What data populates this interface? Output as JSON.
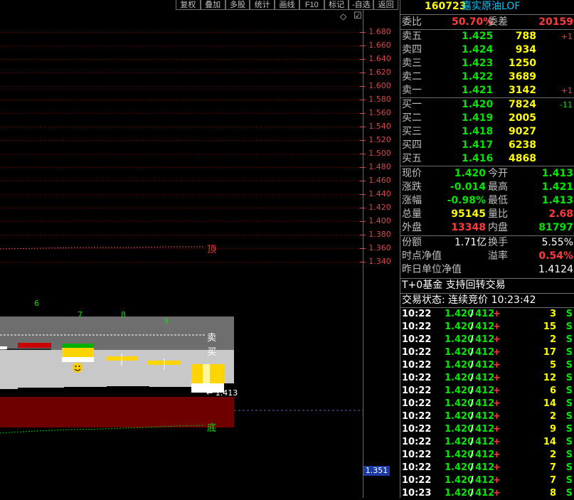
{
  "toolbar": {
    "items": [
      "复权",
      "叠加",
      "多股",
      "统计",
      "画线",
      "F10",
      "标记",
      "-自选",
      "返回"
    ]
  },
  "chart": {
    "price_axis": [
      "1.680",
      "1.660",
      "1.640",
      "1.620",
      "1.600",
      "1.580",
      "1.560",
      "1.540",
      "1.520",
      "1.500",
      "1.480",
      "1.460",
      "1.440",
      "1.420",
      "1.400",
      "1.380",
      "1.360",
      "1.340"
    ],
    "current_price_marker": "1.351",
    "top_label": "顶",
    "bottom_label": "底",
    "sell_label": "卖",
    "buy_label": "买",
    "low_annotation": "← 1.413",
    "count_labels": [
      "6",
      "7",
      "8",
      "9"
    ],
    "diamond_icon": "◇",
    "checkbox_icon": "☑"
  },
  "header": {
    "code": "160723",
    "name": "嘉实原油LOF"
  },
  "ratio": {
    "label1": "委比",
    "value1": "50.70%",
    "label2": "委差",
    "value2": "20159"
  },
  "asks": [
    {
      "label": "卖五",
      "price": "1.425",
      "vol": "788",
      "chg": "+1"
    },
    {
      "label": "卖四",
      "price": "1.424",
      "vol": "934",
      "chg": ""
    },
    {
      "label": "卖三",
      "price": "1.423",
      "vol": "1250",
      "chg": ""
    },
    {
      "label": "卖二",
      "price": "1.422",
      "vol": "3689",
      "chg": ""
    },
    {
      "label": "卖一",
      "price": "1.421",
      "vol": "3142",
      "chg": "+1"
    }
  ],
  "bids": [
    {
      "label": "买一",
      "price": "1.420",
      "vol": "7824",
      "chg": "-11"
    },
    {
      "label": "买二",
      "price": "1.419",
      "vol": "2005",
      "chg": ""
    },
    {
      "label": "买三",
      "price": "1.418",
      "vol": "9027",
      "chg": ""
    },
    {
      "label": "买四",
      "price": "1.417",
      "vol": "6238",
      "chg": ""
    },
    {
      "label": "买五",
      "price": "1.416",
      "vol": "4868",
      "chg": ""
    }
  ],
  "quote": [
    {
      "l1": "现价",
      "v1": "1.420",
      "l2": "今开",
      "v2": "1.413"
    },
    {
      "l1": "涨跌",
      "v1": "-0.014",
      "l2": "最高",
      "v2": "1.421"
    },
    {
      "l1": "涨幅",
      "v1": "-0.98%",
      "l2": "最低",
      "v2": "1.413"
    },
    {
      "l1": "总量",
      "v1": "95145",
      "l2": "量比",
      "v2": "2.68"
    },
    {
      "l1": "外盘",
      "v1": "13348",
      "l2": "内盘",
      "v2": "81797"
    }
  ],
  "fund": {
    "amount_label": "份额",
    "amount": "1.71亿",
    "turnover_label": "换手",
    "turnover": "5.55%",
    "nav_label": "时点净值",
    "premium_label": "溢率",
    "premium": "0.54%",
    "prev_nav_label": "昨日单位净值",
    "prev_nav": "1.4124"
  },
  "info": {
    "t0": "T+0基金 支持回转交易",
    "status": "交易状态: 连续竞价 10:23:42"
  },
  "ticks": [
    {
      "time": "10:22",
      "price": "1.420",
      "sub": "412",
      "dir": "+",
      "vol": "3",
      "side": "S"
    },
    {
      "time": "10:22",
      "price": "1.420",
      "sub": "412",
      "dir": "+",
      "vol": "15",
      "side": "S"
    },
    {
      "time": "10:22",
      "price": "1.420",
      "sub": "412",
      "dir": "+",
      "vol": "2",
      "side": "S"
    },
    {
      "time": "10:22",
      "price": "1.420",
      "sub": "412",
      "dir": "+",
      "vol": "17",
      "side": "S"
    },
    {
      "time": "10:22",
      "price": "1.420",
      "sub": "412",
      "dir": "+",
      "vol": "5",
      "side": "S"
    },
    {
      "time": "10:22",
      "price": "1.420",
      "sub": "412",
      "dir": "+",
      "vol": "12",
      "side": "S"
    },
    {
      "time": "10:22",
      "price": "1.420",
      "sub": "412",
      "dir": "+",
      "vol": "6",
      "side": "S"
    },
    {
      "time": "10:22",
      "price": "1.420",
      "sub": "412",
      "dir": "+",
      "vol": "14",
      "side": "S"
    },
    {
      "time": "10:22",
      "price": "1.420",
      "sub": "412",
      "dir": "+",
      "vol": "2",
      "side": "S"
    },
    {
      "time": "10:22",
      "price": "1.420",
      "sub": "412",
      "dir": "+",
      "vol": "9",
      "side": "S"
    },
    {
      "time": "10:22",
      "price": "1.420",
      "sub": "412",
      "dir": "+",
      "vol": "14",
      "side": "S"
    },
    {
      "time": "10:22",
      "price": "1.420",
      "sub": "412",
      "dir": "+",
      "vol": "2",
      "side": "S"
    },
    {
      "time": "10:22",
      "price": "1.420",
      "sub": "412",
      "dir": "+",
      "vol": "7",
      "side": "S"
    },
    {
      "time": "10:22",
      "price": "1.420",
      "sub": "412",
      "dir": "+",
      "vol": "7",
      "side": "S"
    },
    {
      "time": "10:23",
      "price": "1.420",
      "sub": "412",
      "dir": "+",
      "vol": "8",
      "side": "S"
    }
  ],
  "colors": {
    "red": "#ff3b3b",
    "green": "#00e600",
    "yellow": "#ffff00",
    "white": "#ffffff",
    "label": "#c0c0c0",
    "cyan": "#00c8ff",
    "axis": "#d84848",
    "border": "#6c6c6c"
  }
}
